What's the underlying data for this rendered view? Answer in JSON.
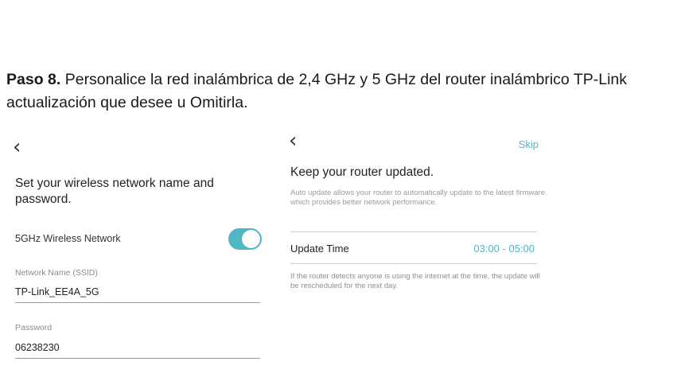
{
  "instruction": {
    "step": "Paso 8.",
    "line1": " Personalice la red inalámbrica de 2,4 GHz y 5 GHz del router inalámbrico TP-Link",
    "line2": "actualización que desee u Omitirla."
  },
  "left_screen": {
    "back_icon": "chevron-left-icon",
    "back_glyph": "‹",
    "title": "Set your wireless network name and password.",
    "toggle": {
      "label": "5GHz Wireless Network",
      "state": "on",
      "color": "#4fb8c4"
    },
    "ssid": {
      "label": "Network Name (SSID)",
      "value": "TP-Link_EE4A_5G"
    },
    "password": {
      "label": "Password",
      "value": "06238230"
    }
  },
  "right_screen": {
    "back_icon": "chevron-left-icon",
    "back_glyph": "‹",
    "skip_label": "Skip",
    "title": "Keep your router updated.",
    "description": "Auto update allows your router to automatically update to the latest firmware which provides better network performance.",
    "update_time_label": "Update Time",
    "update_time_value": "03:00 - 05:00",
    "note": "If the router detects anyone is using the internet at the time, the update will be rescheduled for the next day.",
    "accent_color": "#4fb8c4"
  }
}
